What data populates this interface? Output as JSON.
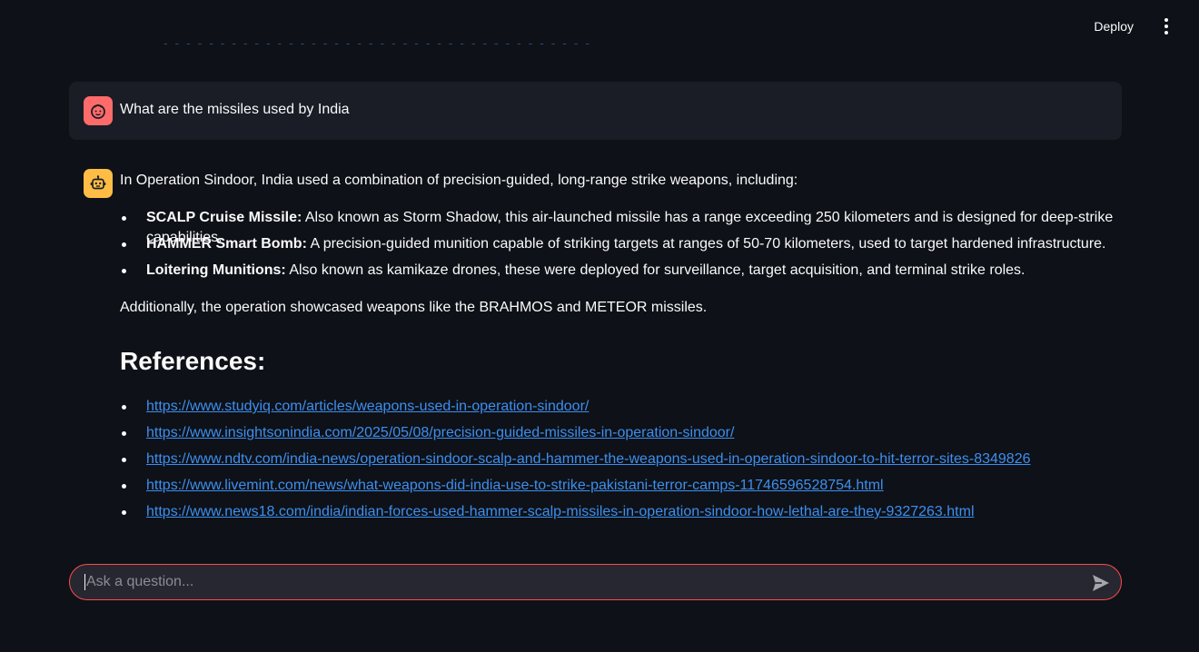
{
  "header": {
    "deploy_label": "Deploy",
    "menu_icon": "kebab-menu-icon"
  },
  "user_message": {
    "avatar_icon": "user-face-icon",
    "avatar_color": "#ff6b6b",
    "text": "What are the missiles used by India"
  },
  "assistant_message": {
    "avatar_icon": "robot-icon",
    "avatar_color": "#ffbd45",
    "intro": "In Operation Sindoor, India used a combination of precision-guided, long-range strike weapons, including:",
    "bullets": [
      {
        "title": "SCALP Cruise Missile:",
        "text": " Also known as Storm Shadow, this air-launched missile has a range exceeding 250 kilometers and is designed for deep-strike capabilities."
      },
      {
        "title": "HAMMER Smart Bomb:",
        "text": " A precision-guided munition capable of striking targets at ranges of 50-70 kilometers, used to target hardened infrastructure."
      },
      {
        "title": "Loitering Munitions:",
        "text": " Also known as kamikaze drones, these were deployed for surveillance, target acquisition, and terminal strike roles."
      }
    ],
    "additional": "Additionally, the operation showcased weapons like the BRAHMOS and METEOR missiles.",
    "references_heading": "References:",
    "references": [
      "https://www.studyiq.com/articles/weapons-used-in-operation-sindoor/",
      "https://www.insightsonindia.com/2025/05/08/precision-guided-missiles-in-operation-sindoor/",
      "https://www.ndtv.com/india-news/operation-sindoor-scalp-and-hammer-the-weapons-used-in-operation-sindoor-to-hit-terror-sites-8349826",
      "https://www.livemint.com/news/what-weapons-did-india-use-to-strike-pakistani-terror-camps-11746596528754.html",
      "https://www.news18.com/india/indian-forces-used-hammer-scalp-missiles-in-operation-sindoor-how-lethal-are-they-9327263.html"
    ]
  },
  "chat_input": {
    "placeholder": "Ask a question...",
    "value": "",
    "send_icon": "send-icon",
    "border_color": "#ff4b4b"
  },
  "colors": {
    "background": "#0e1117",
    "user_bubble": "#1a1d25",
    "link": "#3d8ff0"
  }
}
